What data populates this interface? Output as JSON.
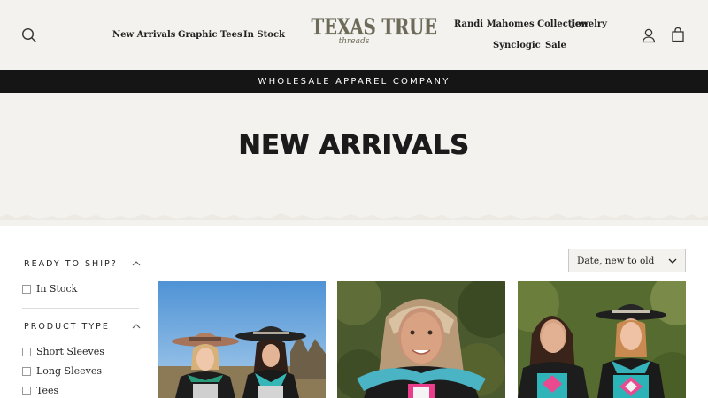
{
  "header": {
    "logo_text": "TEXAS TRUE",
    "logo_subtext": "threads",
    "nav_left": [
      "New Arrivals",
      "Graphic Tees",
      "In Stock"
    ],
    "nav_right_top": [
      "Randi Mahomes Collection",
      "Jewelry"
    ],
    "nav_right_bottom": [
      "Synclogic",
      "Sale"
    ],
    "icons": [
      "search-icon",
      "account-icon",
      "cart-icon"
    ]
  },
  "announcement": {
    "text": "WHOLESALE APPAREL COMPANY"
  },
  "hero": {
    "title": "NEW ARRIVALS"
  },
  "filters": {
    "groups": [
      {
        "title": "READY TO SHIP?",
        "items": [
          "In Stock"
        ]
      },
      {
        "title": "PRODUCT TYPE",
        "items": [
          "Short Sleeves",
          "Long Sleeves",
          "Tees"
        ]
      }
    ]
  },
  "sort": {
    "selected": "Date, new to old"
  },
  "products": [
    {
      "image": "two women in cowboy hats and graphic tees, blue sky"
    },
    {
      "image": "smiling woman with turquoise scarf and graphic tee"
    },
    {
      "image": "two women in western hats with aztec print tees"
    }
  ],
  "colors": {
    "header_bg": "#f4f2ee",
    "announcement_bg": "#151515",
    "logo": "#6d6b58"
  }
}
